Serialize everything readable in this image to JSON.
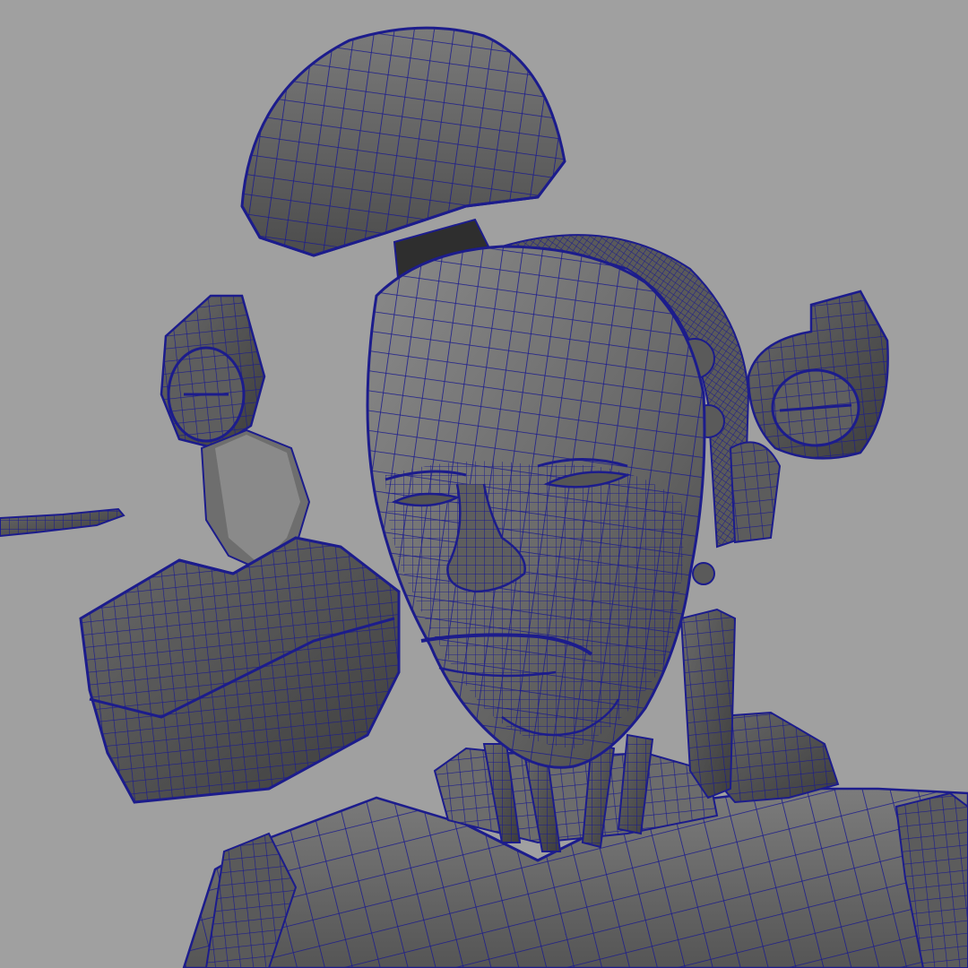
{
  "viewport": {
    "background": "#a0a0a0",
    "shading": "smooth-shade-wireframe-on-shaded",
    "wireframe_color": "#1c1c8c",
    "surface_dark": "#4a4a4a",
    "surface_mid": "#6a6a6a",
    "surface_light": "#8c8c8c"
  },
  "model": {
    "parts": [
      "head",
      "skull-cap",
      "left-ear-cap",
      "right-ear-cap",
      "face-plate",
      "jaw-plate",
      "neck-cables",
      "chest-armor",
      "back-cable-coil",
      "floating-blade"
    ]
  }
}
